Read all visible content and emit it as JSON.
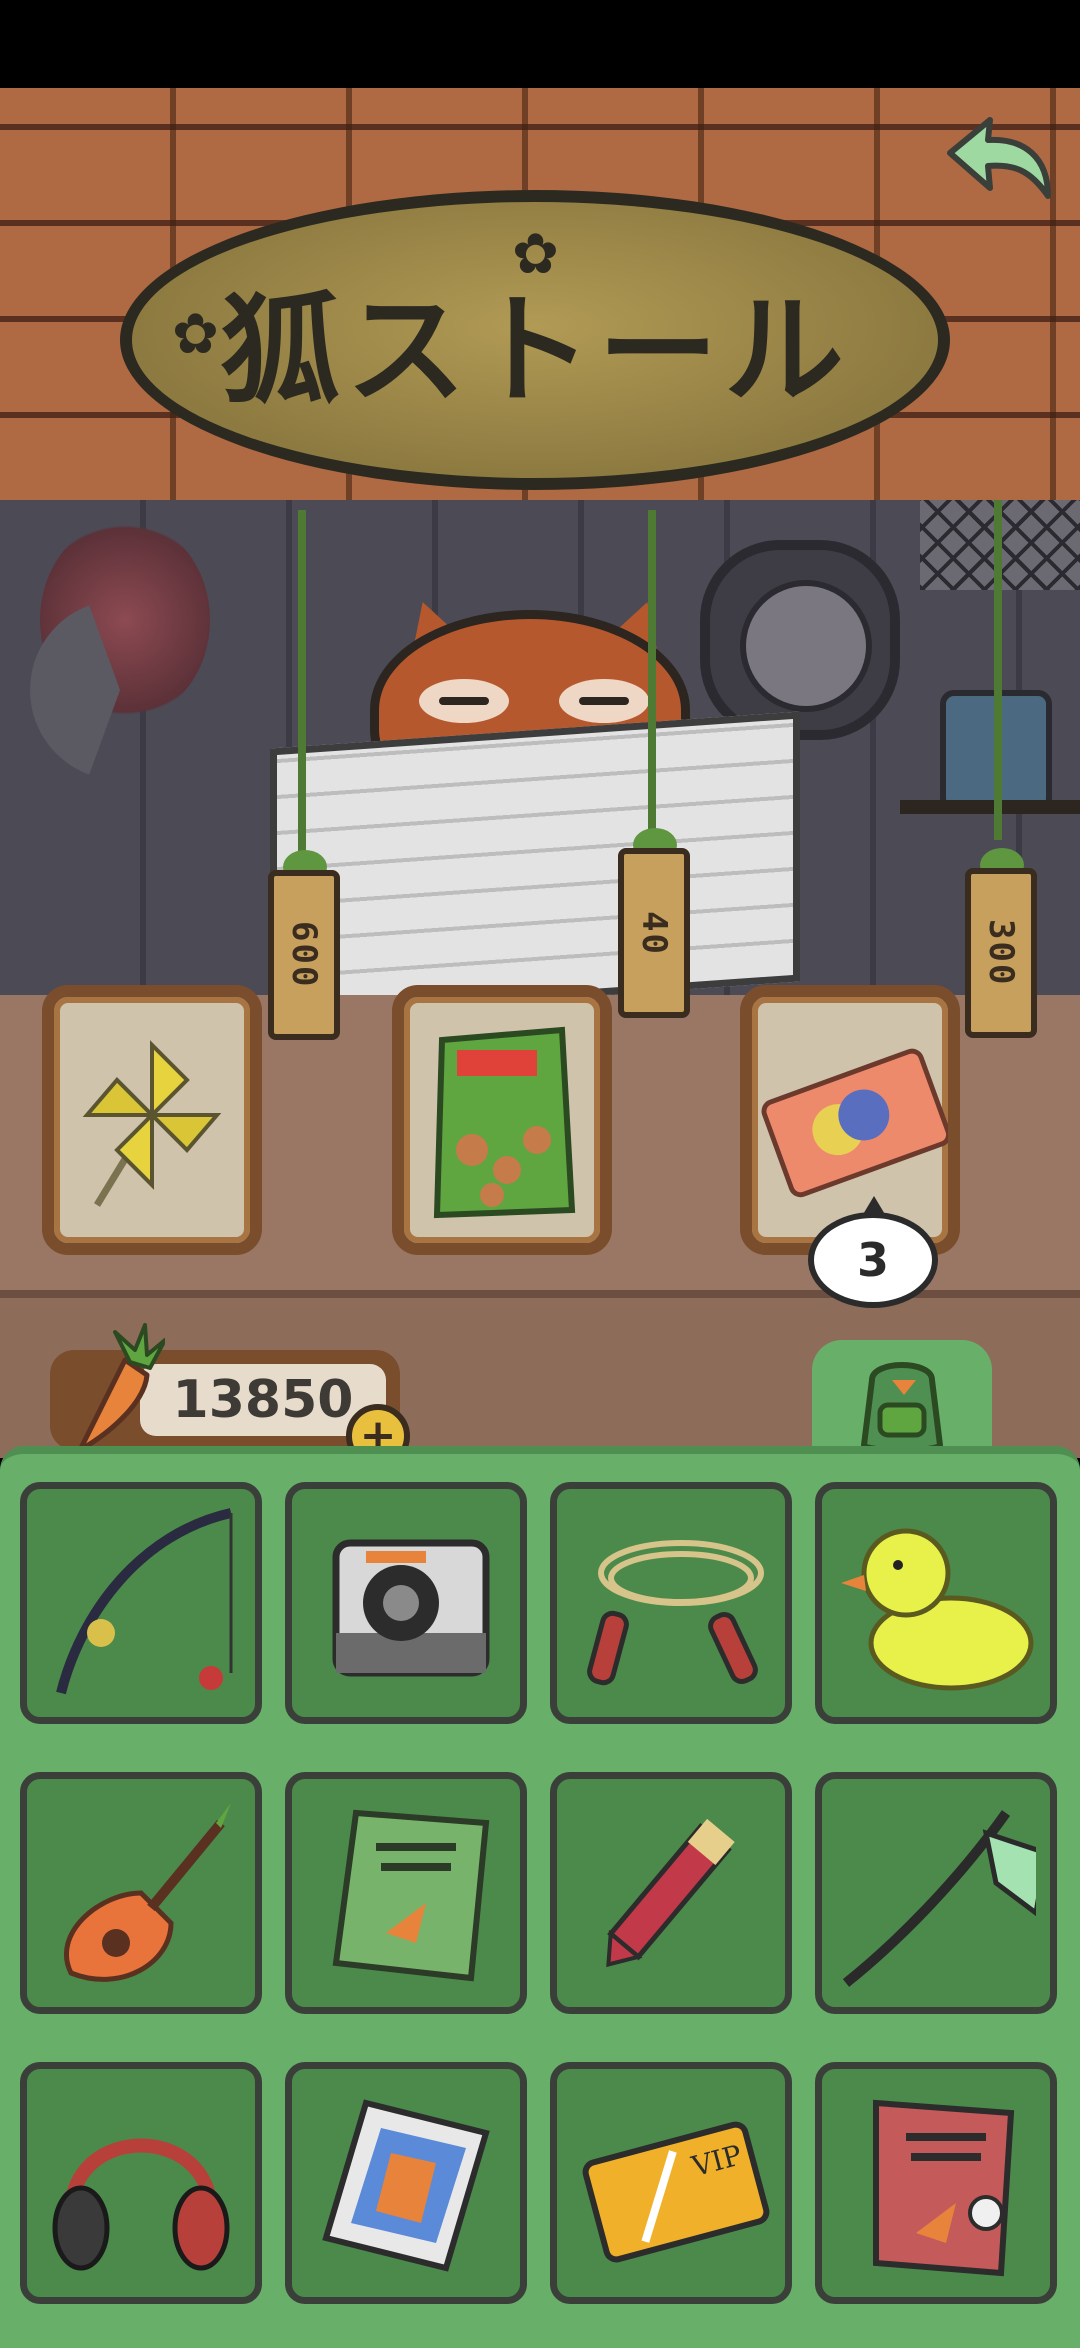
{
  "sign": {
    "title": "狐ストール"
  },
  "shop": {
    "items": [
      {
        "name": "pinwheel",
        "price": "600"
      },
      {
        "name": "snack-bag",
        "price": "40"
      },
      {
        "name": "ticket",
        "price": "300",
        "stock": "3"
      }
    ]
  },
  "currency": {
    "carrots": "13850"
  },
  "icons": {
    "back": "back-arrow-icon",
    "bag": "backpack-icon",
    "carrot": "carrot-icon",
    "plus": "plus-icon"
  },
  "inventory": {
    "items": [
      "fishing-rod",
      "instant-camera",
      "jump-rope",
      "rubber-duck",
      "carrot-ukulele",
      "carrot-book",
      "pencil",
      "guitar-neck",
      "headphones",
      "phone-box",
      "vip-card",
      "carrot-book-2"
    ]
  },
  "colors": {
    "inventory_bg": "#68b06a",
    "slot_bg": "#4b8a4b",
    "roof": "#b06a43",
    "sign": "#b19a55"
  }
}
